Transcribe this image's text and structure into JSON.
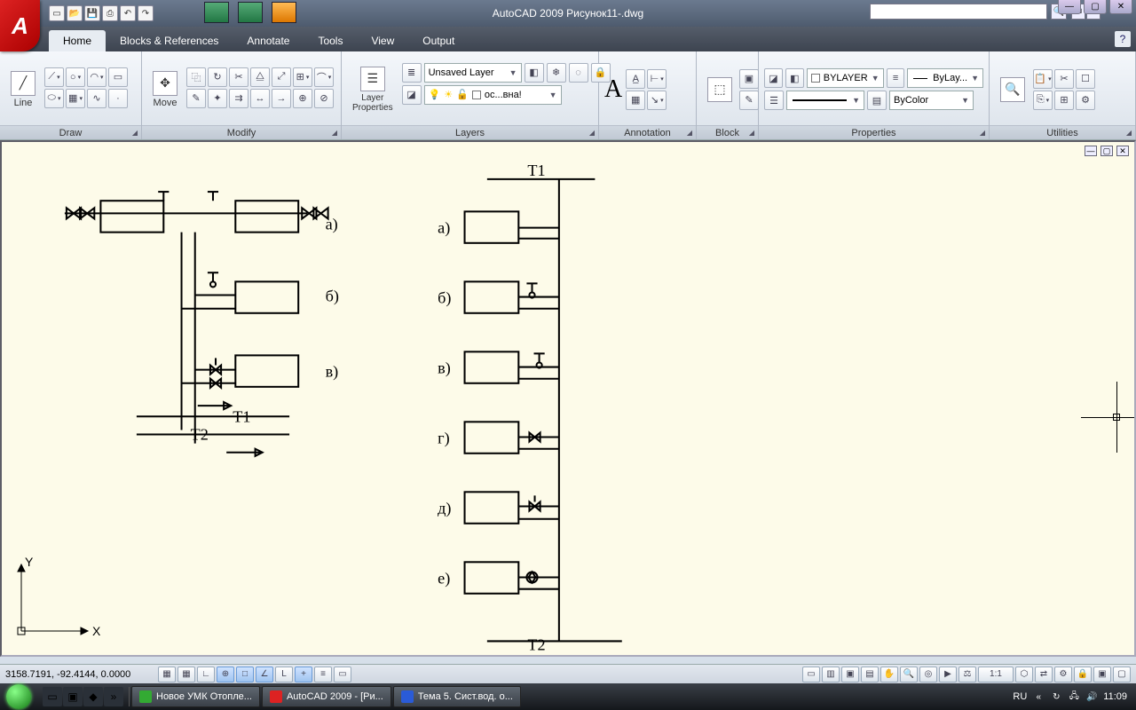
{
  "title": "AutoCAD 2009 Рисунок11-.dwg",
  "logo": "A",
  "tabs": [
    "Home",
    "Blocks & References",
    "Annotate",
    "Tools",
    "View",
    "Output"
  ],
  "panels": {
    "draw": "Draw",
    "modify": "Modify",
    "layers": "Layers",
    "annotation": "Annotation",
    "block": "Block",
    "properties": "Properties",
    "utilities": "Utilities"
  },
  "buttons": {
    "line": "Line",
    "move": "Move",
    "layerprops": "Layer\nProperties",
    "unsaved_layer": "Unsaved Layer",
    "layer_current": "ос...вна!",
    "bylayer": "BYLAYER",
    "bylay": "ByLay...",
    "bycolor": "ByColor"
  },
  "drawing": {
    "left_labels": [
      "а)",
      "б)",
      "в)"
    ],
    "right_labels": [
      "а)",
      "б)",
      "в)",
      "г)",
      "д)",
      "е)"
    ],
    "T1": "T1",
    "T2": "T2",
    "axes": {
      "x": "X",
      "y": "Y"
    }
  },
  "status": {
    "coords": "3158.7191, -92.4144, 0.0000",
    "scale": "1:1"
  },
  "taskbar": {
    "items": [
      "Новое УМК Отопле...",
      "AutoCAD 2009 - [Ри...",
      "Тема 5. Сист.вод. о..."
    ],
    "lang": "RU",
    "time": "11:09"
  }
}
